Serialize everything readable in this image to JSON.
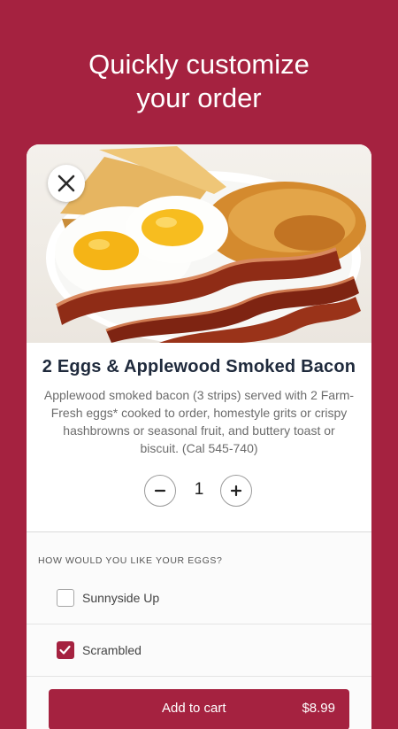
{
  "headline": {
    "line1": "Quickly customize",
    "line2": "your order"
  },
  "item": {
    "title": "2 Eggs & Applewood Smoked Bacon",
    "description": "Applewood smoked bacon (3 strips) served with 2 Farm-Fresh eggs* cooked to order, homestyle grits or crispy hashbrowns or seasonal fruit, and buttery toast or biscuit. (Cal 545-740)"
  },
  "quantity": {
    "value": "1",
    "minus_icon": "minus-icon",
    "plus_icon": "plus-icon"
  },
  "options": {
    "question": "HOW WOULD YOU LIKE YOUR EGGS?",
    "choices": [
      {
        "label": "Sunnyside Up",
        "checked": false
      },
      {
        "label": "Scrambled",
        "checked": true
      }
    ]
  },
  "cart": {
    "label": "Add to cart",
    "price": "$8.99"
  },
  "colors": {
    "brand": "#a52240",
    "title": "#1f2a3c"
  },
  "icons": {
    "close": "close-icon",
    "check": "check-icon"
  }
}
